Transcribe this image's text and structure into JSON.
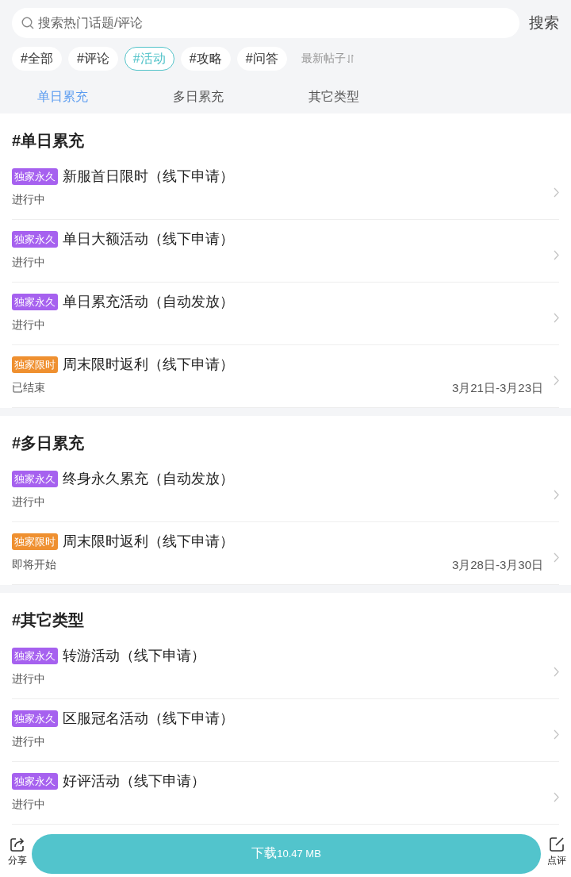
{
  "search": {
    "placeholder": "搜索热门话题/评论",
    "button": "搜索"
  },
  "filters": [
    {
      "label": "#全部",
      "selected": false
    },
    {
      "label": "#评论",
      "selected": false
    },
    {
      "label": "#活动",
      "selected": true
    },
    {
      "label": "#攻略",
      "selected": false
    },
    {
      "label": "#问答",
      "selected": false
    }
  ],
  "sort": {
    "label": "最新帖子"
  },
  "tabs": [
    {
      "label": "单日累充",
      "selected": true
    },
    {
      "label": "多日累充",
      "selected": false
    },
    {
      "label": "其它类型",
      "selected": false
    }
  ],
  "sections": [
    {
      "title": "#单日累充",
      "items": [
        {
          "tag": {
            "label": "独家永久",
            "color": "#a661ef"
          },
          "title": "新服首日限时（线下申请）",
          "status": "进行中"
        },
        {
          "tag": {
            "label": "独家永久",
            "color": "#a661ef"
          },
          "title": "单日大额活动（线下申请）",
          "status": "进行中"
        },
        {
          "tag": {
            "label": "独家永久",
            "color": "#a661ef"
          },
          "title": "单日累充活动（自动发放）",
          "status": "进行中"
        },
        {
          "tag": {
            "label": "独家限时",
            "color": "#ef9030"
          },
          "title": "周末限时返利（线下申请）",
          "status": "已结束",
          "date": "3月21日-3月23日"
        }
      ]
    },
    {
      "title": "#多日累充",
      "items": [
        {
          "tag": {
            "label": "独家永久",
            "color": "#a661ef"
          },
          "title": "终身永久累充（自动发放）",
          "status": "进行中"
        },
        {
          "tag": {
            "label": "独家限时",
            "color": "#ef9030"
          },
          "title": "周末限时返利（线下申请）",
          "status": "即将开始",
          "date": "3月28日-3月30日"
        }
      ]
    },
    {
      "title": "#其它类型",
      "items": [
        {
          "tag": {
            "label": "独家永久",
            "color": "#a661ef"
          },
          "title": "转游活动（线下申请）",
          "status": "进行中"
        },
        {
          "tag": {
            "label": "独家永久",
            "color": "#a661ef"
          },
          "title": "区服冠名活动（线下申请）",
          "status": "进行中"
        },
        {
          "tag": {
            "label": "独家永久",
            "color": "#a661ef"
          },
          "title": "好评活动（线下申请）",
          "status": "进行中"
        }
      ]
    }
  ],
  "bottom_bar": {
    "share": "分享",
    "download": "下载",
    "size": "10.47 MB",
    "review": "点评"
  }
}
